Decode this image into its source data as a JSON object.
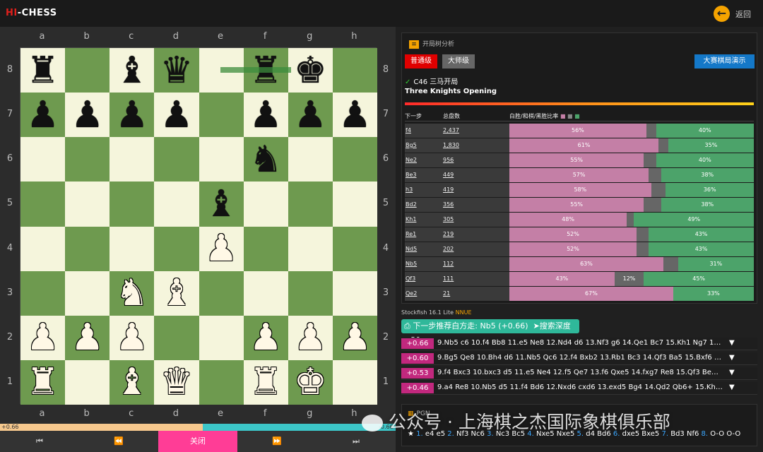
{
  "header": {
    "logo_hi": "HI",
    "logo_rest": "-CHESS",
    "back_label": "返回"
  },
  "board": {
    "files": [
      "a",
      "b",
      "c",
      "d",
      "e",
      "f",
      "g",
      "h"
    ],
    "ranks": [
      "8",
      "7",
      "6",
      "5",
      "4",
      "3",
      "2",
      "1"
    ],
    "position": [
      [
        "bR",
        "",
        "bB",
        "bQ",
        "",
        "bR",
        "bK",
        ""
      ],
      [
        "bP",
        "bP",
        "bP",
        "bP",
        "",
        "bP",
        "bP",
        "bP"
      ],
      [
        "",
        "",
        "",
        "",
        "",
        "bN",
        "",
        ""
      ],
      [
        "",
        "",
        "",
        "",
        "bB",
        "",
        "",
        ""
      ],
      [
        "",
        "",
        "",
        "",
        "wP",
        "",
        "",
        ""
      ],
      [
        "",
        "",
        "wN",
        "wB",
        "",
        "",
        "",
        ""
      ],
      [
        "wP",
        "wP",
        "wP",
        "",
        "",
        "wP",
        "wP",
        "wP"
      ],
      [
        "wR",
        "",
        "wB",
        "wQ",
        "",
        "wR",
        "wK",
        ""
      ]
    ],
    "last_move": "f8-g8"
  },
  "eval_bar": {
    "left_label": "+0.66",
    "right_label": "-0.66",
    "white_fraction": 0.513
  },
  "nav": {
    "first": "⏮",
    "prev": "⏪",
    "close": "关闭",
    "next": "⏩",
    "last": "⏭"
  },
  "tree": {
    "title": "开局树分析",
    "level_normal": "普通级",
    "level_master": "大师级",
    "demo_button": "大赛棋局演示",
    "opening_code": "C46 三马开局",
    "opening_name": "Three Knights Opening",
    "col_next": "下一步",
    "col_total": "总盘数",
    "col_ratio": "白胜/和棋/黑胜比率",
    "rows": [
      {
        "move": "f4",
        "games": "2,437",
        "w": 56,
        "d": 4,
        "b": 40,
        "wl": "56%",
        "dl": "",
        "bl": "40%"
      },
      {
        "move": "Bg5",
        "games": "1,830",
        "w": 61,
        "d": 4,
        "b": 35,
        "wl": "61%",
        "dl": "",
        "bl": "35%"
      },
      {
        "move": "Ne2",
        "games": "956",
        "w": 55,
        "d": 5,
        "b": 40,
        "wl": "55%",
        "dl": "",
        "bl": "40%"
      },
      {
        "move": "Be3",
        "games": "449",
        "w": 57,
        "d": 5,
        "b": 38,
        "wl": "57%",
        "dl": "",
        "bl": "38%"
      },
      {
        "move": "h3",
        "games": "419",
        "w": 58,
        "d": 6,
        "b": 36,
        "wl": "58%",
        "dl": "",
        "bl": "36%"
      },
      {
        "move": "Bd2",
        "games": "356",
        "w": 55,
        "d": 7,
        "b": 38,
        "wl": "55%",
        "dl": "",
        "bl": "38%"
      },
      {
        "move": "Kh1",
        "games": "305",
        "w": 48,
        "d": 3,
        "b": 49,
        "wl": "48%",
        "dl": "",
        "bl": "49%"
      },
      {
        "move": "Re1",
        "games": "219",
        "w": 52,
        "d": 5,
        "b": 43,
        "wl": "52%",
        "dl": "",
        "bl": "43%"
      },
      {
        "move": "Nd5",
        "games": "202",
        "w": 52,
        "d": 5,
        "b": 43,
        "wl": "52%",
        "dl": "",
        "bl": "43%"
      },
      {
        "move": "Nb5",
        "games": "112",
        "w": 63,
        "d": 6,
        "b": 31,
        "wl": "63%",
        "dl": "",
        "bl": "31%"
      },
      {
        "move": "Qf3",
        "games": "111",
        "w": 43,
        "d": 12,
        "b": 45,
        "wl": "43%",
        "dl": "12%",
        "bl": "45%"
      },
      {
        "move": "Qe2",
        "games": "21",
        "w": 67,
        "d": 0,
        "b": 33,
        "wl": "67%",
        "dl": "",
        "bl": "33%"
      }
    ]
  },
  "engine": {
    "name": "Stockfish 16.1",
    "lite": "Lite",
    "nnue": "NNUE",
    "recommend": "下一步推荐白方走: Nb5 (+0.66)",
    "depth": "搜索深度=30",
    "lines": [
      {
        "eval": "+0.66",
        "moves": "9.Nb5 c6 10.f4 Bb8 11.e5 Ne8 12.Nd4 d6 13.Nf3 g6 14.Qe1 Bc7 15.Kh1 Ng7 16..."
      },
      {
        "eval": "+0.60",
        "moves": "9.Bg5 Qe8 10.Bh4 d6 11.Nb5 Qc6 12.f4 Bxb2 13.Rb1 Bc3 14.Qf3 Ba5 15.Bxf6 g..."
      },
      {
        "eval": "+0.53",
        "moves": "9.f4 Bxc3 10.bxc3 d5 11.e5 Ne4 12.f5 Qe7 13.f6 Qxe5 14.fxg7 Re8 15.Qf3 Be6 ..."
      },
      {
        "eval": "+0.46",
        "moves": "9.a4 Re8 10.Nb5 d5 11.f4 Bd6 12.Nxd6 cxd6 13.exd5 Bg4 14.Qd2 Qb6+ 15.Kh1 ..."
      }
    ]
  },
  "pgn": {
    "title": "PGN",
    "moves": [
      {
        "n": "1.",
        "m": "e4 e5"
      },
      {
        "n": "2.",
        "m": "Nf3 Nc6"
      },
      {
        "n": "3.",
        "m": "Nc3 Bc5"
      },
      {
        "n": "4.",
        "m": "Nxe5 Nxe5"
      },
      {
        "n": "5.",
        "m": "d4 Bd6"
      },
      {
        "n": "6.",
        "m": "dxe5 Bxe5"
      },
      {
        "n": "7.",
        "m": "Bd3 Nf6"
      },
      {
        "n": "8.",
        "m": "O-O O-O"
      }
    ]
  },
  "watermark": "公众号 · 上海棋之杰国际象棋俱乐部"
}
